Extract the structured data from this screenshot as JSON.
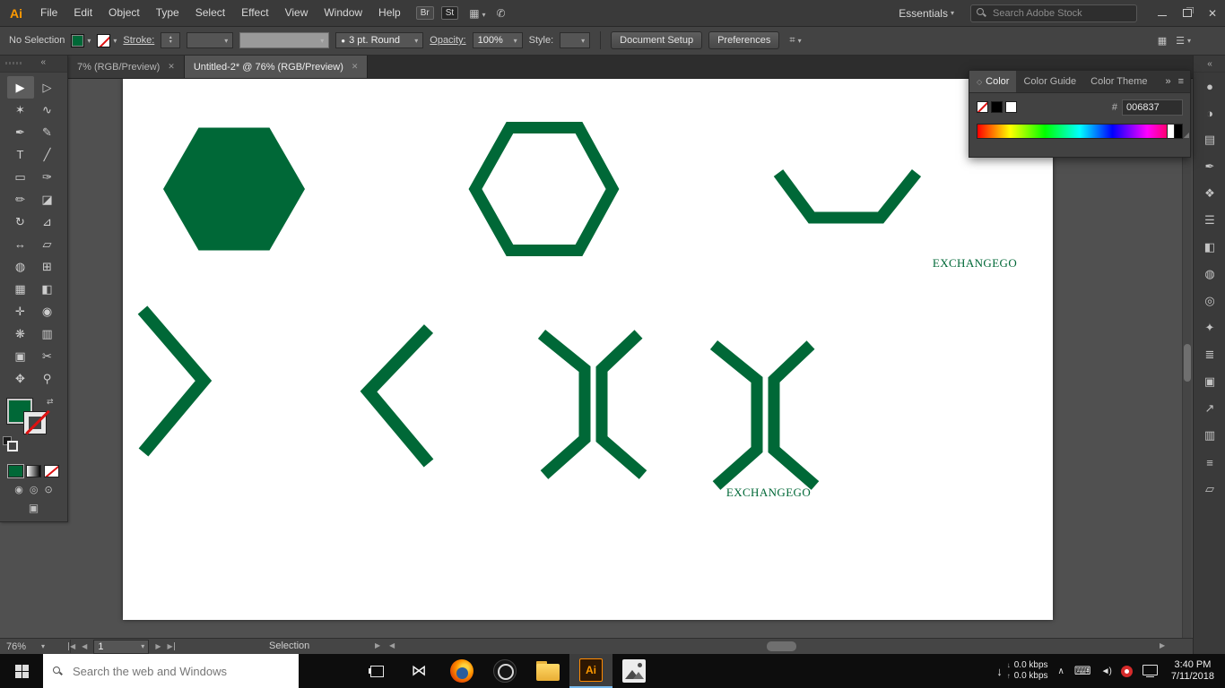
{
  "colors": {
    "green": "#006837"
  },
  "icons": {
    "chevron_down": "▾",
    "chevron_up": "▴",
    "double_chevron_left": "«",
    "double_chevron_right": "»",
    "close": "✕",
    "panel_menu": "≡",
    "swap": "⇄",
    "arrow_down": "↓",
    "arrow_up": "↑",
    "hidden_icons": "∧",
    "keyboard": "⌨",
    "speaker": "◄)",
    "media_app": "⋈",
    "nav_prev": "◀",
    "nav_next": "▶",
    "scroll_right": "▶",
    "grid": "▦",
    "rows": "☰",
    "share": "✆",
    "brush_dot": "●",
    "draw_normal": "◉",
    "draw_behind": "◎",
    "draw_inside": "⊙",
    "screen_mode": "▣",
    "reference_point": "⌗",
    "resize_grip": "◢",
    "diamond": "◇"
  },
  "menu_bar": {
    "logo": "Ai",
    "menus": [
      "File",
      "Edit",
      "Object",
      "Type",
      "Select",
      "Effect",
      "View",
      "Window",
      "Help"
    ],
    "bridge_label": "Br",
    "stock_label": "St",
    "workspace_label": "Essentials",
    "stock_search_placeholder": "Search Adobe Stock"
  },
  "control_bar": {
    "selection_status": "No Selection",
    "stroke_label": "Stroke:",
    "brush_value": "3 pt. Round",
    "opacity_label": "Opacity:",
    "opacity_value": "100%",
    "style_label": "Style:",
    "document_setup_label": "Document Setup",
    "preferences_label": "Preferences"
  },
  "document_tabs": [
    {
      "label": "7% (RGB/Preview)"
    },
    {
      "label": "Untitled-2* @ 76% (RGB/Preview)"
    }
  ],
  "tools": [
    {
      "name": "selection-tool",
      "glyph": "▶"
    },
    {
      "name": "direct-selection-tool",
      "glyph": "▷"
    },
    {
      "name": "magic-wand-tool",
      "glyph": "✶"
    },
    {
      "name": "lasso-tool",
      "glyph": "∿"
    },
    {
      "name": "pen-tool",
      "glyph": "✒"
    },
    {
      "name": "curvature-tool",
      "glyph": "✎"
    },
    {
      "name": "type-tool",
      "glyph": "T"
    },
    {
      "name": "line-segment-tool",
      "glyph": "╱"
    },
    {
      "name": "rectangle-tool",
      "glyph": "▭"
    },
    {
      "name": "paintbrush-tool",
      "glyph": "✑"
    },
    {
      "name": "shaper-tool",
      "glyph": "✏"
    },
    {
      "name": "eraser-tool",
      "glyph": "◪"
    },
    {
      "name": "rotate-tool",
      "glyph": "↻"
    },
    {
      "name": "scale-tool",
      "glyph": "⊿"
    },
    {
      "name": "width-tool",
      "glyph": "↔"
    },
    {
      "name": "free-transform-tool",
      "glyph": "▱"
    },
    {
      "name": "shape-builder-tool",
      "glyph": "◍"
    },
    {
      "name": "perspective-grid-tool",
      "glyph": "⊞"
    },
    {
      "name": "mesh-tool",
      "glyph": "▦"
    },
    {
      "name": "gradient-tool",
      "glyph": "◧"
    },
    {
      "name": "eyedropper-tool",
      "glyph": "✛"
    },
    {
      "name": "blend-tool",
      "glyph": "◉"
    },
    {
      "name": "symbol-sprayer-tool",
      "glyph": "❋"
    },
    {
      "name": "column-graph-tool",
      "glyph": "▥"
    },
    {
      "name": "artboard-tool",
      "glyph": "▣"
    },
    {
      "name": "slice-tool",
      "glyph": "✂"
    },
    {
      "name": "hand-tool",
      "glyph": "✥"
    },
    {
      "name": "zoom-tool",
      "glyph": "⚲"
    }
  ],
  "color_panel": {
    "tab_color": "Color",
    "tab_color_guide": "Color Guide",
    "tab_color_theme": "Color Theme",
    "hex_label": "#",
    "hex_value": "006837"
  },
  "artboard": {
    "text_top": "EXCHANGEGO",
    "text_bottom": "EXCHANGEGO"
  },
  "dock_icons": [
    {
      "name": "dock-icon-color",
      "glyph": "●"
    },
    {
      "name": "dock-icon-color-guide",
      "glyph": "◑"
    },
    {
      "name": "dock-icon-swatches",
      "glyph": "▤"
    },
    {
      "name": "dock-icon-brushes",
      "glyph": "✒"
    },
    {
      "name": "dock-icon-symbols",
      "glyph": "❖"
    },
    {
      "name": "dock-icon-stroke",
      "glyph": "☰"
    },
    {
      "name": "dock-icon-gradient",
      "glyph": "◧"
    },
    {
      "name": "dock-icon-transparency",
      "glyph": "◍"
    },
    {
      "name": "dock-icon-appearance",
      "glyph": "◎"
    },
    {
      "name": "dock-icon-graphic-styles",
      "glyph": "✦"
    },
    {
      "name": "dock-icon-layers",
      "glyph": "≣"
    },
    {
      "name": "dock-icon-artboards",
      "glyph": "▣"
    },
    {
      "name": "dock-icon-asset-export",
      "glyph": "↗"
    },
    {
      "name": "dock-icon-column-graph",
      "glyph": "▥"
    },
    {
      "name": "dock-icon-align",
      "glyph": "≡"
    },
    {
      "name": "dock-icon-transform",
      "glyph": "▱"
    }
  ],
  "status_bar": {
    "zoom_value": "76%",
    "artboard_field": "1",
    "status_text": "Selection"
  },
  "taskbar": {
    "search_placeholder": "Search the web and Windows",
    "ai_label": "Ai",
    "net_rows": [
      {
        "dir": "down",
        "value": "0.0 kbps"
      },
      {
        "dir": "up",
        "value": "0.0 kbps"
      }
    ],
    "clock_time": "3:40 PM",
    "clock_date": "7/11/2018"
  }
}
